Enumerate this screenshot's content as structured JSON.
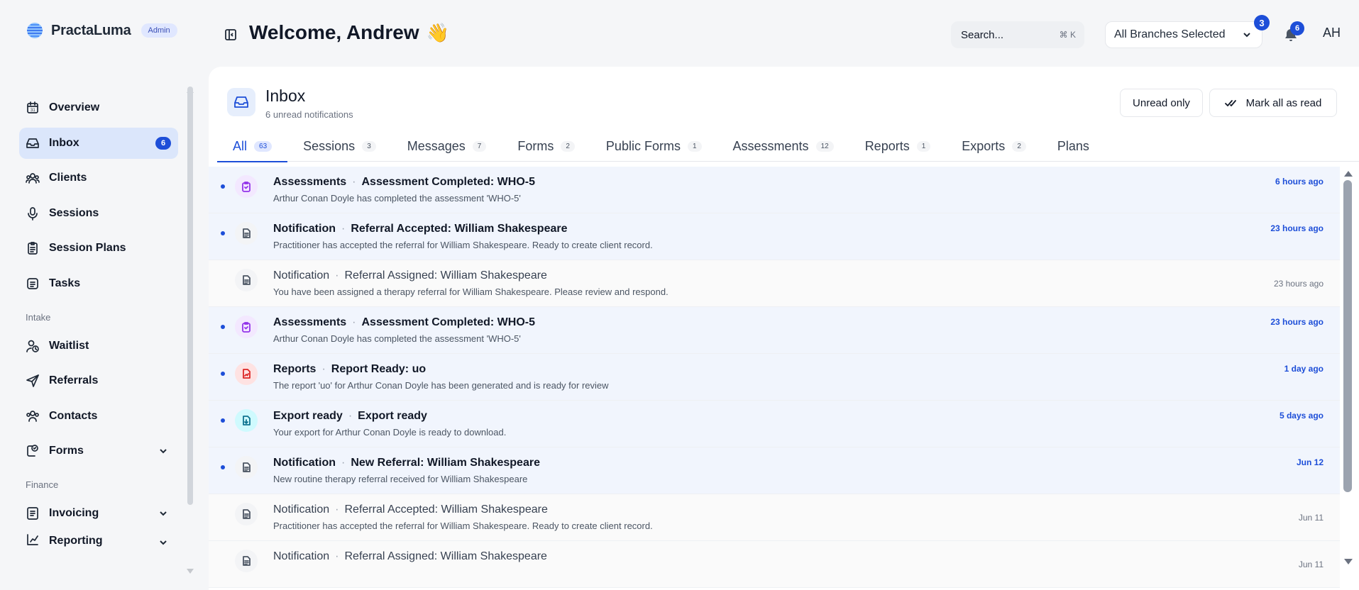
{
  "brand": {
    "name": "PractaLuma",
    "badge": "Admin"
  },
  "sidebar": {
    "items": [
      {
        "label": "Overview",
        "icon": "calendar-icon"
      },
      {
        "label": "Inbox",
        "icon": "inbox-icon",
        "count": "6",
        "active": true
      },
      {
        "label": "Clients",
        "icon": "users-icon"
      },
      {
        "label": "Sessions",
        "icon": "mic-icon"
      },
      {
        "label": "Session Plans",
        "icon": "clipboard-icon"
      },
      {
        "label": "Tasks",
        "icon": "list-icon"
      }
    ],
    "intake_label": "Intake",
    "intake_items": [
      {
        "label": "Waitlist",
        "icon": "user-clock-icon"
      },
      {
        "label": "Referrals",
        "icon": "send-icon"
      },
      {
        "label": "Contacts",
        "icon": "contacts-icon"
      },
      {
        "label": "Forms",
        "icon": "forms-icon",
        "expandable": true
      }
    ],
    "finance_label": "Finance",
    "finance_items": [
      {
        "label": "Invoicing",
        "icon": "invoice-icon",
        "expandable": true
      },
      {
        "label": "Reporting",
        "icon": "chart-icon",
        "expandable": true
      }
    ]
  },
  "header": {
    "welcome": "Welcome, Andrew",
    "wave": "👋",
    "search_placeholder": "Search...",
    "search_kbd": "⌘ K",
    "branch": "All Branches Selected",
    "branch_badge": "3",
    "bell_badge": "6",
    "avatar": "AH"
  },
  "inbox": {
    "title": "Inbox",
    "subtitle": "6 unread notifications",
    "unread_only": "Unread only",
    "mark_all": "Mark all as read",
    "tabs": [
      {
        "label": "All",
        "count": "63"
      },
      {
        "label": "Sessions",
        "count": "3"
      },
      {
        "label": "Messages",
        "count": "7"
      },
      {
        "label": "Forms",
        "count": "2"
      },
      {
        "label": "Public Forms",
        "count": "1"
      },
      {
        "label": "Assessments",
        "count": "12"
      },
      {
        "label": "Reports",
        "count": "1"
      },
      {
        "label": "Exports",
        "count": "2"
      },
      {
        "label": "Plans",
        "count": ""
      }
    ],
    "notifications": [
      {
        "category": "Assessments",
        "subject": "Assessment Completed: WHO-5",
        "desc": "Arthur Conan Doyle has completed the assessment 'WHO-5'",
        "time": "6 hours ago",
        "unread": true,
        "icon": "clipboard-check-icon",
        "tone": "purple"
      },
      {
        "category": "Notification",
        "subject": "Referral Accepted: William Shakespeare",
        "desc": "Practitioner has accepted the referral for William Shakespeare. Ready to create client record.",
        "time": "23 hours ago",
        "unread": true,
        "icon": "document-icon",
        "tone": "gray"
      },
      {
        "category": "Notification",
        "subject": "Referral Assigned: William Shakespeare",
        "desc": "You have been assigned a therapy referral for William Shakespeare. Please review and respond.",
        "time": "23 hours ago",
        "unread": false,
        "icon": "document-icon",
        "tone": "gray"
      },
      {
        "category": "Assessments",
        "subject": "Assessment Completed: WHO-5",
        "desc": "Arthur Conan Doyle has completed the assessment 'WHO-5'",
        "time": "23 hours ago",
        "unread": true,
        "icon": "clipboard-check-icon",
        "tone": "purple"
      },
      {
        "category": "Reports",
        "subject": "Report Ready: uo",
        "desc": "The report 'uo' for Arthur Conan Doyle has been generated and is ready for review",
        "time": "1 day ago",
        "unread": true,
        "icon": "report-icon",
        "tone": "red"
      },
      {
        "category": "Export ready",
        "subject": "Export ready",
        "desc": "Your export for Arthur Conan Doyle is ready to download.",
        "time": "5 days ago",
        "unread": true,
        "icon": "export-icon",
        "tone": "cyan"
      },
      {
        "category": "Notification",
        "subject": "New Referral: William Shakespeare",
        "desc": "New routine therapy referral received for William Shakespeare",
        "time": "Jun 12",
        "unread": true,
        "icon": "document-icon",
        "tone": "gray"
      },
      {
        "category": "Notification",
        "subject": "Referral Accepted: William Shakespeare",
        "desc": "Practitioner has accepted the referral for William Shakespeare. Ready to create client record.",
        "time": "Jun 11",
        "unread": false,
        "icon": "document-icon",
        "tone": "gray"
      },
      {
        "category": "Notification",
        "subject": "Referral Assigned: William Shakespeare",
        "desc": "",
        "time": "Jun 11",
        "unread": false,
        "icon": "document-icon",
        "tone": "gray"
      }
    ]
  }
}
